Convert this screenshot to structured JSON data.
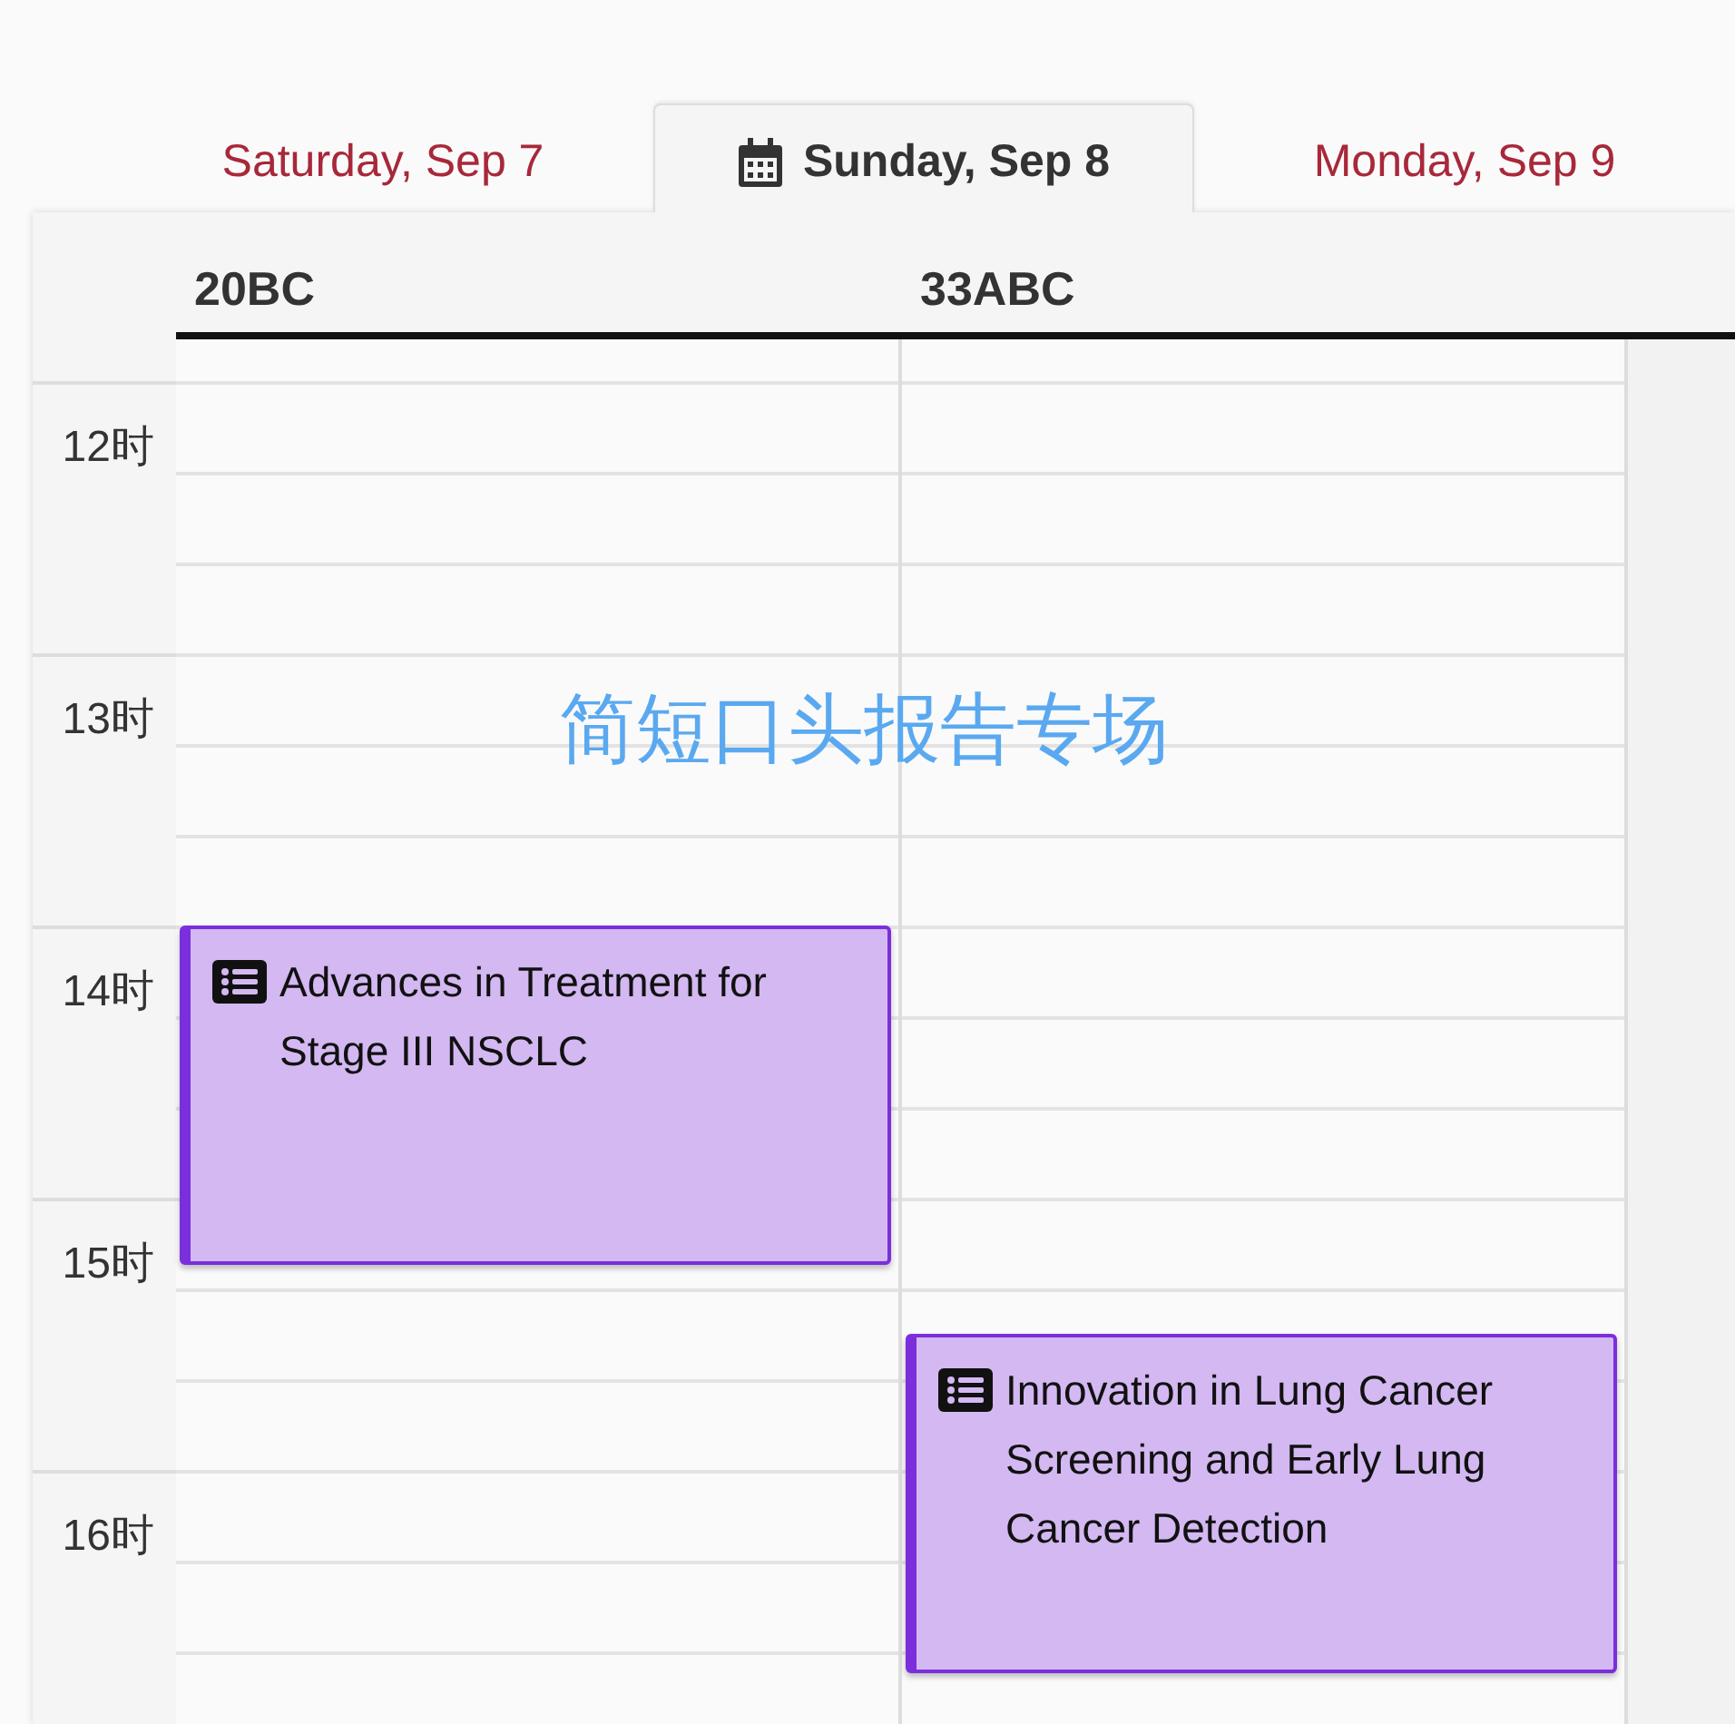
{
  "tabs": [
    {
      "label": "Saturday, Sep 7",
      "selected": false
    },
    {
      "label": "Sunday, Sep 8",
      "selected": true
    },
    {
      "label": "Monday, Sep 9",
      "selected": false
    }
  ],
  "rooms": [
    {
      "name": "20BC",
      "events": [
        {
          "title": "Advances in Treatment for Stage III NSCLC"
        }
      ]
    },
    {
      "name": "33ABC",
      "events": [
        {
          "title": "Innovation in Lung Cancer Screening and Early Lung Cancer Detection"
        }
      ]
    }
  ],
  "hours": [
    "12时",
    "13时",
    "14时",
    "15时",
    "16时"
  ],
  "overlay_caption": "简短口头报告专场"
}
